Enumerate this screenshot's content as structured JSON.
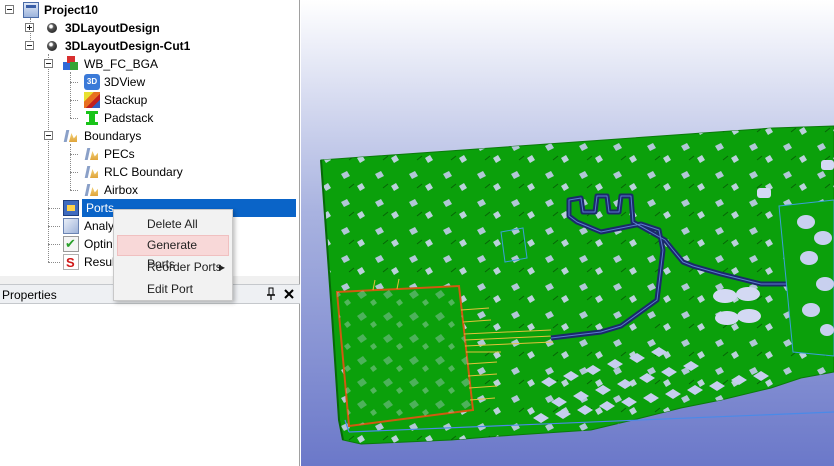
{
  "tree": {
    "project": "Project10",
    "design1": "3DLayoutDesign",
    "design2": "3DLayoutDesign-Cut1",
    "layout": "WB_FC_BGA",
    "view3d": "3DView",
    "view3d_icon_text": "3D",
    "stackup": "Stackup",
    "padstack": "Padstack",
    "boundarys": "Boundarys",
    "pecs": "PECs",
    "rlc": "RLC Boundary",
    "airbox": "Airbox",
    "ports": "Ports",
    "analysis": "Analy",
    "optim": "Optin",
    "results": "Resul"
  },
  "properties": {
    "title": "Properties",
    "pin_glyph": "⊣",
    "close_glyph": "✕"
  },
  "context_menu": {
    "items": [
      "Delete All Ports",
      "Generate Ports",
      "Reorder Ports",
      "Edit Port"
    ],
    "submenu_arrow": "▶",
    "hovered_index": 1
  },
  "colors": {
    "selection": "#0a64c8",
    "board_green": "#0ba00b",
    "menu_hover": "#f8d8d8",
    "trace_navy": "#1a2a6a"
  },
  "icons": [
    "project-icon",
    "design-icon",
    "layout-icon",
    "view3d-icon",
    "stackup-icon",
    "padstack-icon",
    "boundary-icon",
    "ports-icon",
    "analysis-icon",
    "optimetrics-icon",
    "results-icon",
    "pin-icon",
    "close-icon"
  ]
}
